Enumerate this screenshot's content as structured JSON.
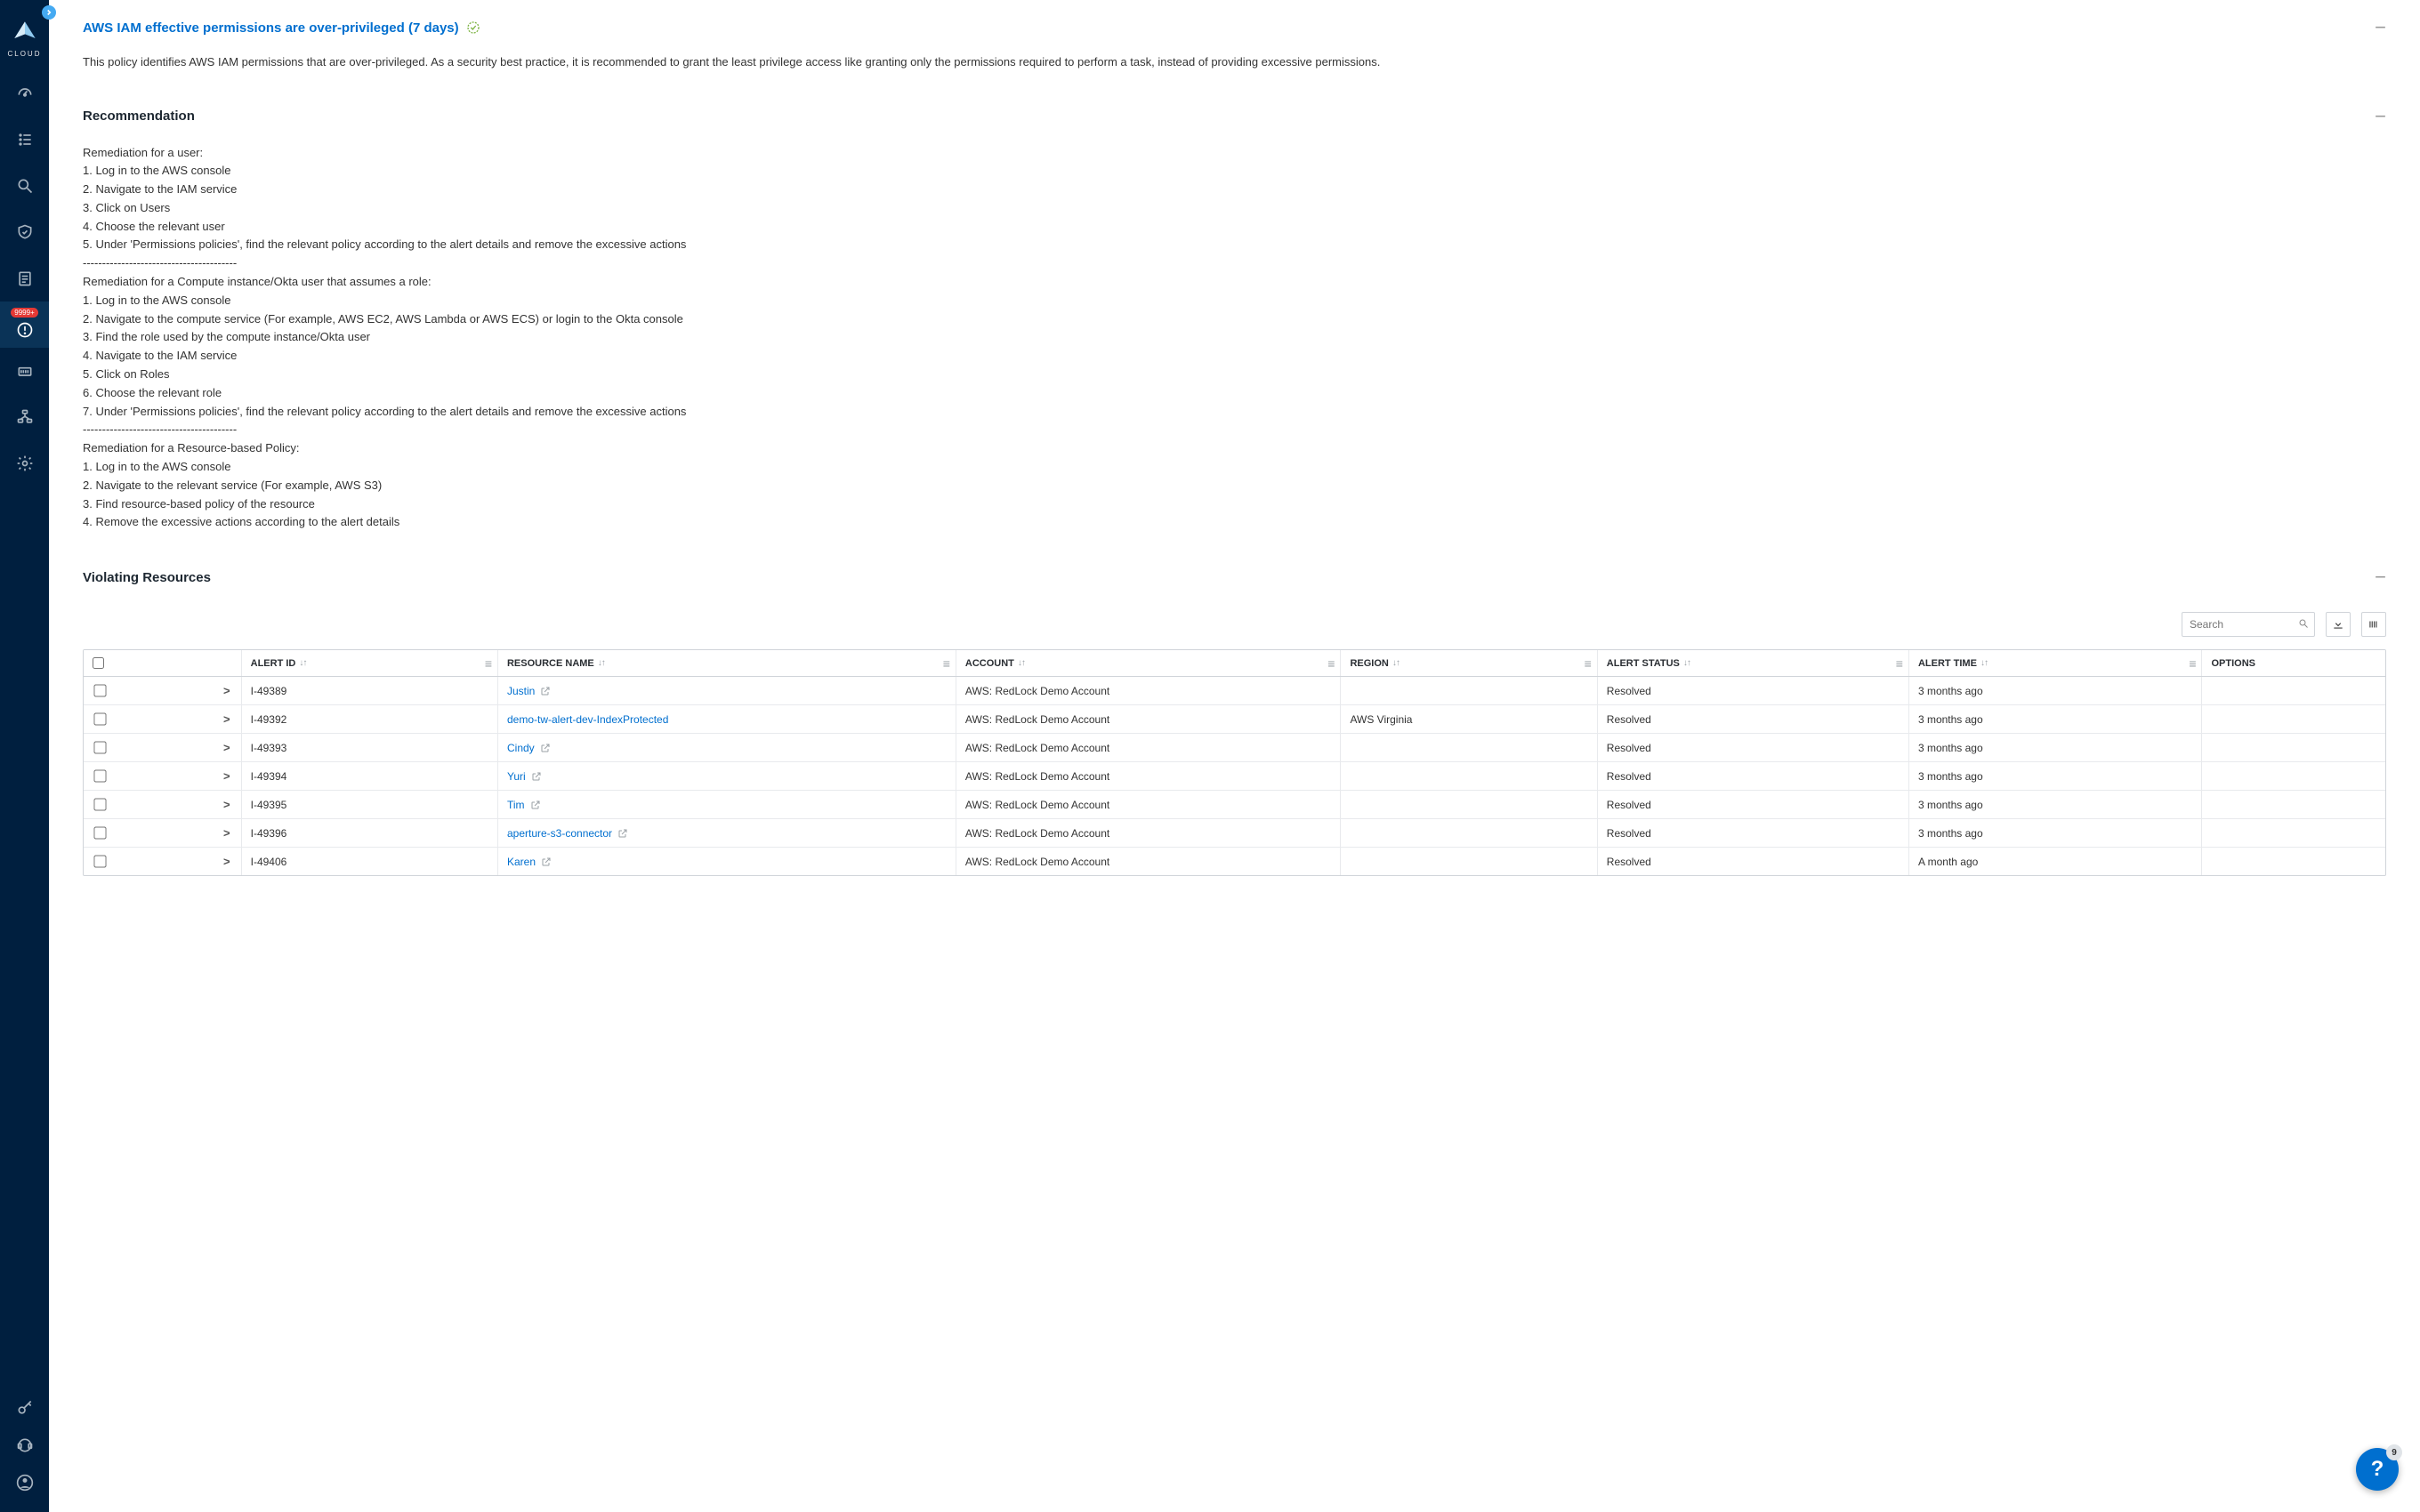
{
  "brand": "CLOUD",
  "sidebar": {
    "badge": "9999+"
  },
  "policy": {
    "title": "AWS IAM effective permissions are over-privileged (7 days)",
    "description": "This policy identifies AWS IAM permissions that are over-privileged. As a security best practice, it is recommended to grant the least privilege access like granting only the permissions required to perform a task, instead of providing excessive permissions."
  },
  "recommendation": {
    "heading": "Recommendation",
    "body": "Remediation for a user:\n1. Log in to the AWS console\n2. Navigate to the IAM service\n3. Click on Users\n4. Choose the relevant user\n5. Under 'Permissions policies', find the relevant policy according to the alert details and remove the excessive actions\n----------------------------------------\nRemediation for a Compute instance/Okta user that assumes a role:\n1. Log in to the AWS console\n2. Navigate to the compute service (For example, AWS EC2, AWS Lambda or AWS ECS) or login to the Okta console\n3. Find the role used by the compute instance/Okta user\n4. Navigate to the IAM service\n5. Click on Roles\n6. Choose the relevant role\n7. Under 'Permissions policies', find the relevant policy according to the alert details and remove the excessive actions\n----------------------------------------\nRemediation for a Resource-based Policy:\n1. Log in to the AWS console\n2. Navigate to the relevant service (For example, AWS S3)\n3. Find resource-based policy of the resource\n4. Remove the excessive actions according to the alert details"
  },
  "violating": {
    "heading": "Violating Resources"
  },
  "search": {
    "placeholder": "Search"
  },
  "columns": {
    "alert_id": "ALERT ID",
    "resource_name": "RESOURCE NAME",
    "account": "ACCOUNT",
    "region": "REGION",
    "alert_status": "ALERT STATUS",
    "alert_time": "ALERT TIME",
    "options": "OPTIONS"
  },
  "rows": [
    {
      "alert_id": "I-49389",
      "resource": "Justin",
      "has_ext": true,
      "account": "AWS: RedLock Demo Account",
      "region": "",
      "status": "Resolved",
      "time": "3 months ago"
    },
    {
      "alert_id": "I-49392",
      "resource": "demo-tw-alert-dev-IndexProtected",
      "has_ext": false,
      "account": "AWS: RedLock Demo Account",
      "region": "AWS Virginia",
      "status": "Resolved",
      "time": "3 months ago"
    },
    {
      "alert_id": "I-49393",
      "resource": "Cindy",
      "has_ext": true,
      "account": "AWS: RedLock Demo Account",
      "region": "",
      "status": "Resolved",
      "time": "3 months ago"
    },
    {
      "alert_id": "I-49394",
      "resource": "Yuri",
      "has_ext": true,
      "account": "AWS: RedLock Demo Account",
      "region": "",
      "status": "Resolved",
      "time": "3 months ago"
    },
    {
      "alert_id": "I-49395",
      "resource": "Tim",
      "has_ext": true,
      "account": "AWS: RedLock Demo Account",
      "region": "",
      "status": "Resolved",
      "time": "3 months ago"
    },
    {
      "alert_id": "I-49396",
      "resource": "aperture-s3-connector",
      "has_ext": true,
      "account": "AWS: RedLock Demo Account",
      "region": "",
      "status": "Resolved",
      "time": "3 months ago"
    },
    {
      "alert_id": "I-49406",
      "resource": "Karen",
      "has_ext": true,
      "account": "AWS: RedLock Demo Account",
      "region": "",
      "status": "Resolved",
      "time": "A month ago"
    }
  ],
  "help": {
    "count": "9"
  }
}
